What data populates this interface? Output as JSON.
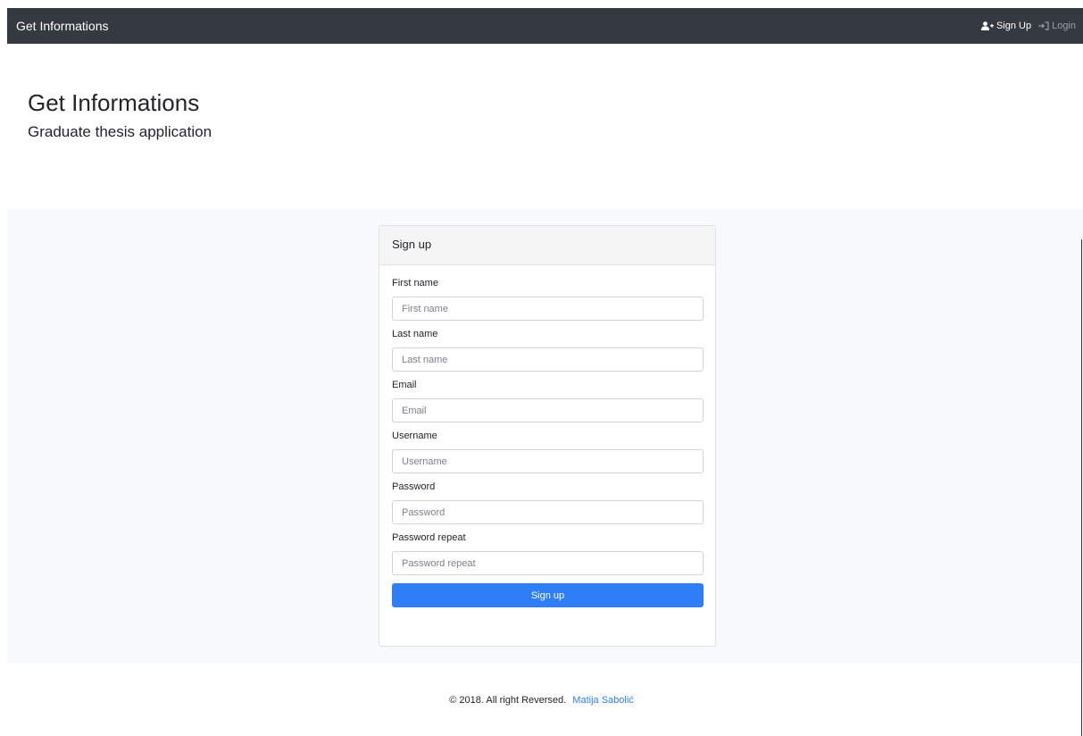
{
  "navbar": {
    "brand": "Get Informations",
    "links": [
      {
        "label": "Sign Up",
        "icon": "user-plus-icon",
        "active": true
      },
      {
        "label": "Login",
        "icon": "sign-in-icon",
        "active": false
      }
    ]
  },
  "header": {
    "title": "Get Informations",
    "subtitle": "Graduate thesis application"
  },
  "form": {
    "title": "Sign up",
    "fields": [
      {
        "label": "First name",
        "placeholder": "First name",
        "value": ""
      },
      {
        "label": "Last name",
        "placeholder": "Last name",
        "value": ""
      },
      {
        "label": "Email",
        "placeholder": "Email",
        "value": ""
      },
      {
        "label": "Username",
        "placeholder": "Username",
        "value": ""
      },
      {
        "label": "Password",
        "placeholder": "Password",
        "value": ""
      },
      {
        "label": "Password repeat",
        "placeholder": "Password repeat",
        "value": ""
      }
    ],
    "submit_label": "Sign up"
  },
  "footer": {
    "copyright": "© 2018. All right Reversed.",
    "author": "Matija Sabolić"
  },
  "colors": {
    "navbar_bg": "#343a40",
    "primary": "#2f7ef6",
    "band_bg": "#f8f9fa"
  }
}
